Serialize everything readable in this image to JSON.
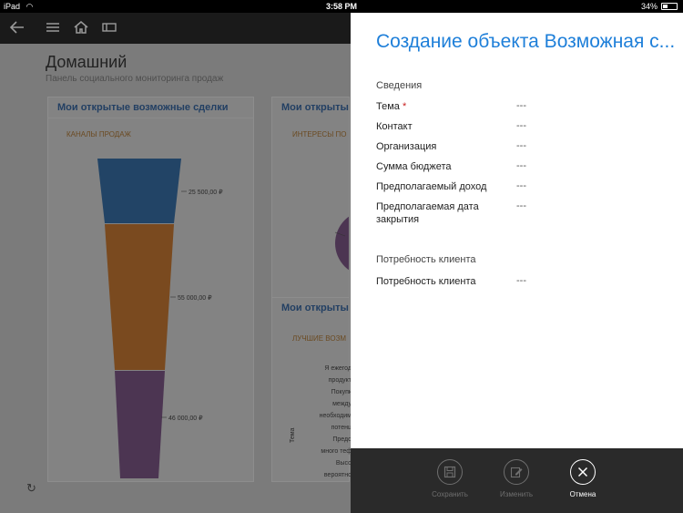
{
  "statusbar": {
    "device": "iPad",
    "time": "3:58 PM",
    "battery": "34%",
    "battery_level": 0.34
  },
  "dashboard": {
    "title": "Домашний",
    "subtitle": "Панель социального мониторинга продаж",
    "card1": {
      "title": "Мои открытые возможные сделки",
      "subtitle": "КАНАЛЫ ПРОДАЖ",
      "labels": [
        "25 500,00 ₽",
        "55 000,00 ₽",
        "46 000,00 ₽"
      ]
    },
    "card2": {
      "title": "Мои открытые",
      "subtitle": "ИНТЕРЕСЫ ПО"
    },
    "card3": {
      "title": "Мои открыты",
      "subtitle": "ЛУЧШИЕ ВОЗМ"
    },
    "side_texts": [
      "Я ежегод",
      "продукт",
      "Покупк",
      "между",
      "необходим",
      "потенц",
      "Предо",
      "много теф",
      "Высо",
      "вероятно"
    ],
    "axis_label": "Тема"
  },
  "panel": {
    "title": "Создание объекта Возможная с...",
    "section_details": "Сведения",
    "fields": [
      {
        "label": "Тема",
        "value": "---",
        "required": "*"
      },
      {
        "label": "Контакт",
        "value": "---"
      },
      {
        "label": "Организация",
        "value": "---"
      },
      {
        "label": "Сумма бюджета",
        "value": "---"
      },
      {
        "label": "Предполагаемый доход",
        "value": "---"
      },
      {
        "label": "Предполагаемая дата закрытия",
        "value": "---"
      }
    ],
    "section_needs": "Потребность клиента",
    "needs_field": {
      "label": "Потребность клиента",
      "value": "---"
    }
  },
  "commands": {
    "save": "Сохранить",
    "edit": "Изменить",
    "cancel": "Отмена"
  },
  "colors": {
    "accent": "#1e7fd9",
    "funnel_top": "#224466",
    "funnel_mid": "#7a4a1f",
    "funnel_bottom": "#4c3552",
    "pie_purple": "#4c3552"
  }
}
